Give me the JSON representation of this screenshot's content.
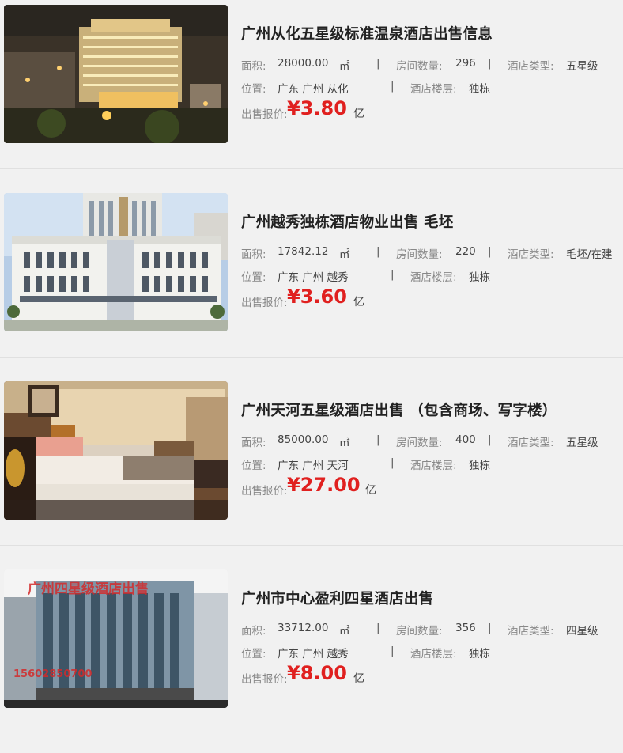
{
  "labels": {
    "area": "面积:",
    "rooms": "房间数量:",
    "hotel_type": "酒店类型:",
    "location": "位置:",
    "floors": "酒店楼层:",
    "price": "出售报价:",
    "area_unit": "㎡",
    "separator": "|"
  },
  "listings": [
    {
      "title": "广州从化五星级标准温泉酒店出售信息",
      "area": "28000.00",
      "rooms": "296",
      "hotel_type": "五星级",
      "location": "广东 广州 从化",
      "floors": "独栋",
      "price": "¥3.80",
      "price_unit": "亿"
    },
    {
      "title": "广州越秀独栋酒店物业出售 毛坯",
      "area": "17842.12",
      "rooms": "220",
      "hotel_type": "毛坯/在建",
      "location": "广东 广州 越秀",
      "floors": "独栋",
      "price": "¥3.60",
      "price_unit": "亿"
    },
    {
      "title": "广州天河五星级酒店出售 （包含商场、写字楼）",
      "area": "85000.00",
      "rooms": "400",
      "hotel_type": "五星级",
      "location": "广东 广州 天河",
      "floors": "独栋",
      "price": "¥27.00",
      "price_unit": "亿"
    },
    {
      "title": "广州市中心盈利四星酒店出售",
      "area": "33712.00",
      "rooms": "356",
      "hotel_type": "四星级",
      "location": "广东 广州 越秀",
      "floors": "独栋",
      "price": "¥8.00",
      "price_unit": "亿",
      "image_caption": "广州四星级酒店出售",
      "image_phone": "15602850700"
    }
  ]
}
